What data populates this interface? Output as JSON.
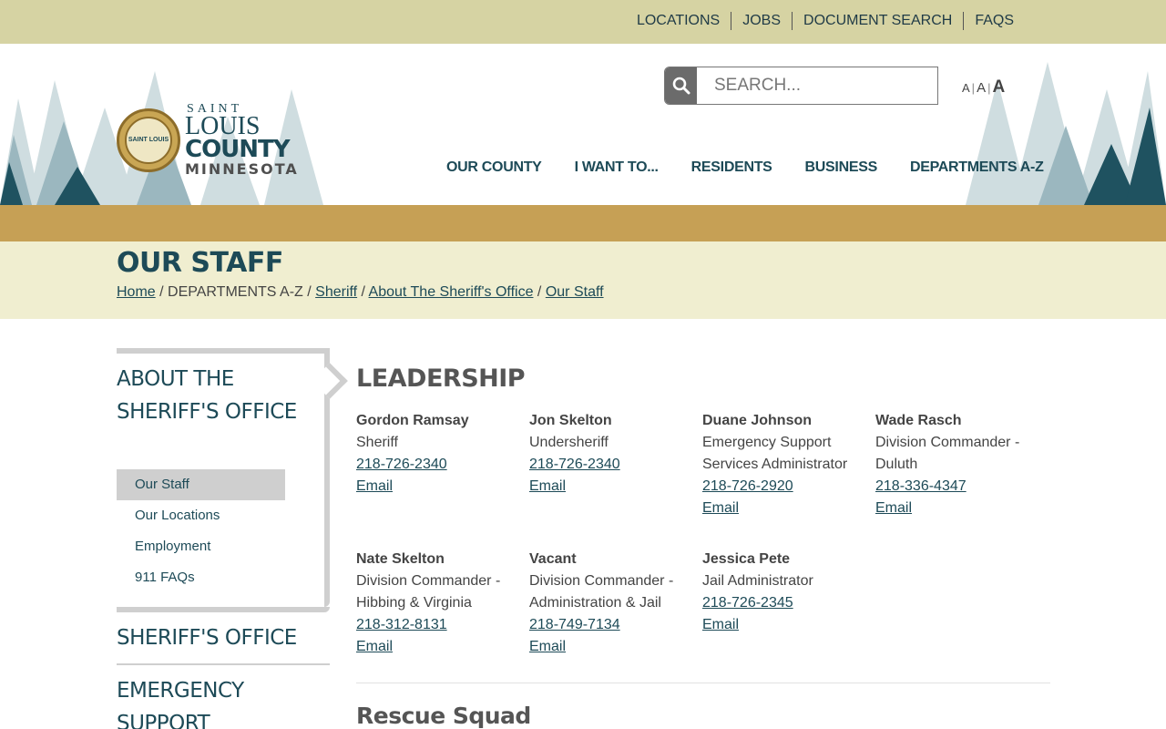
{
  "utility_nav": [
    "LOCATIONS",
    "JOBS",
    "DOCUMENT SEARCH",
    "FAQS"
  ],
  "logo": {
    "seal_text": "SAINT LOUIS",
    "line1": "SAINT",
    "line2": "LOUIS",
    "line3": "COUNTY",
    "line4": "MINNESOTA"
  },
  "search": {
    "placeholder": "SEARCH..."
  },
  "text_size": [
    "A",
    "A",
    "A"
  ],
  "main_nav": [
    "OUR COUNTY",
    "I WANT TO...",
    "RESIDENTS",
    "BUSINESS",
    "DEPARTMENTS A-Z"
  ],
  "page_title": "OUR STAFF",
  "breadcrumb": {
    "home": "Home",
    "sep": " / ",
    "departments": "DEPARTMENTS A-Z",
    "sheriff": "Sheriff",
    "about": "About The Sheriff's Office",
    "current": "Our Staff"
  },
  "sidebar": {
    "heading": "ABOUT THE SHERIFF'S OFFICE",
    "items": [
      "Our Staff",
      "Our Locations",
      "Employment",
      "911 FAQs"
    ],
    "section1": "SHERIFF'S OFFICE",
    "section2": "EMERGENCY SUPPORT"
  },
  "leadership": {
    "title": "LEADERSHIP",
    "staff": [
      {
        "name": "Gordon Ramsay",
        "title": "Sheriff",
        "phone": "218-726-2340",
        "email": "Email"
      },
      {
        "name": "Jon Skelton",
        "title": "Undersheriff",
        "phone": "218-726-2340",
        "email": "Email"
      },
      {
        "name": "Duane Johnson",
        "title": "Emergency Support Services Administrator",
        "phone": "218-726-2920",
        "email": "Email"
      },
      {
        "name": "Wade Rasch",
        "title": "Division Commander - Duluth",
        "phone": "218-336-4347",
        "email": "Email"
      },
      {
        "name": "Nate Skelton",
        "title": "Division Commander - Hibbing & Virginia",
        "phone": "218-312-8131",
        "email": "Email"
      },
      {
        "name": "Vacant",
        "title": "Division Commander - Administration & Jail",
        "phone": "218-749-7134",
        "email": "Email"
      },
      {
        "name": "Jessica Pete",
        "title": "Jail Administrator",
        "phone": "218-726-2345",
        "email": "Email"
      }
    ]
  },
  "next_section": "Rescue Squad",
  "colors": {
    "utility_bar": "#d6d3a3",
    "gold_band": "#c6a055",
    "title_band": "#f0eed0",
    "brand_teal": "#1d4a57"
  }
}
